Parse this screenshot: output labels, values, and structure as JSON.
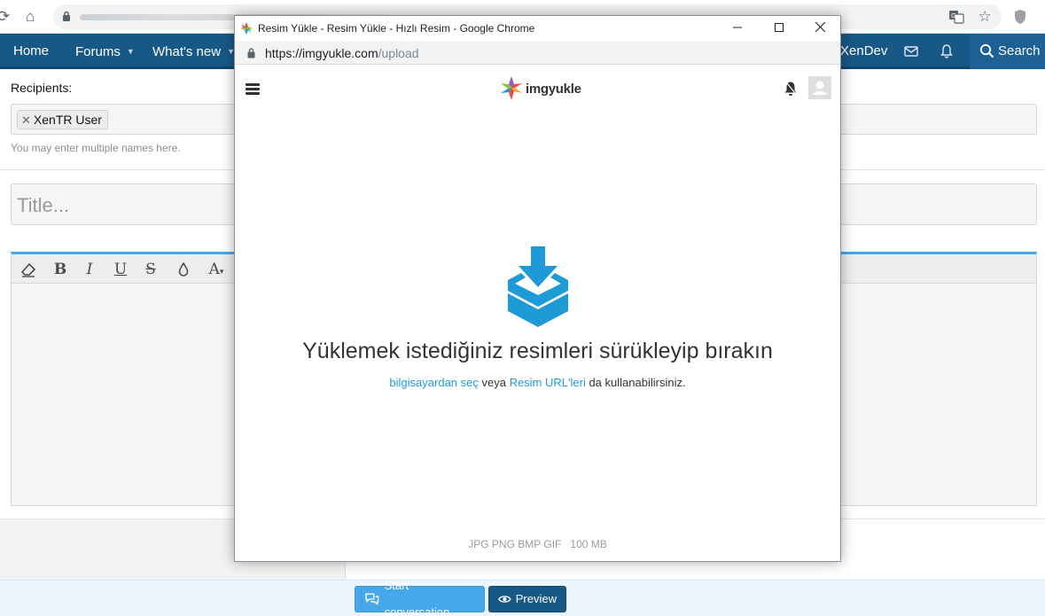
{
  "background": {
    "forum_nav": {
      "home": "Home",
      "forums": "Forums",
      "whats_new": "What's new",
      "user": "XenDev",
      "search": "Search"
    },
    "form": {
      "recipients_label": "Recipients:",
      "recipient_token": "XenTR User",
      "recipients_hint": "You may enter multiple names here.",
      "title_placeholder": "Title...",
      "start_conversation": "Start conversation",
      "preview": "Preview"
    }
  },
  "popup": {
    "window_title": "Resim Yükle - Resim Yükle - Hızlı Resim - Google Chrome",
    "url_host": "https://imgyukle.com",
    "url_path": "/upload",
    "logo_text": "imgyukle",
    "upload_heading": "Yüklemek istediğiniz resimleri sürükleyip bırakın",
    "choose_link": "bilgisayardan seç",
    "or_text": " veya ",
    "url_link": "Resim URL'leri",
    "tail_text": " da kullanabilirsiniz.",
    "formats": "JPG PNG BMP GIF",
    "max_size": "100 MB"
  },
  "colors": {
    "forum_nav": "#185886",
    "accent_blue": "#47a7eb",
    "upload_icon": "#1e9bd7"
  }
}
